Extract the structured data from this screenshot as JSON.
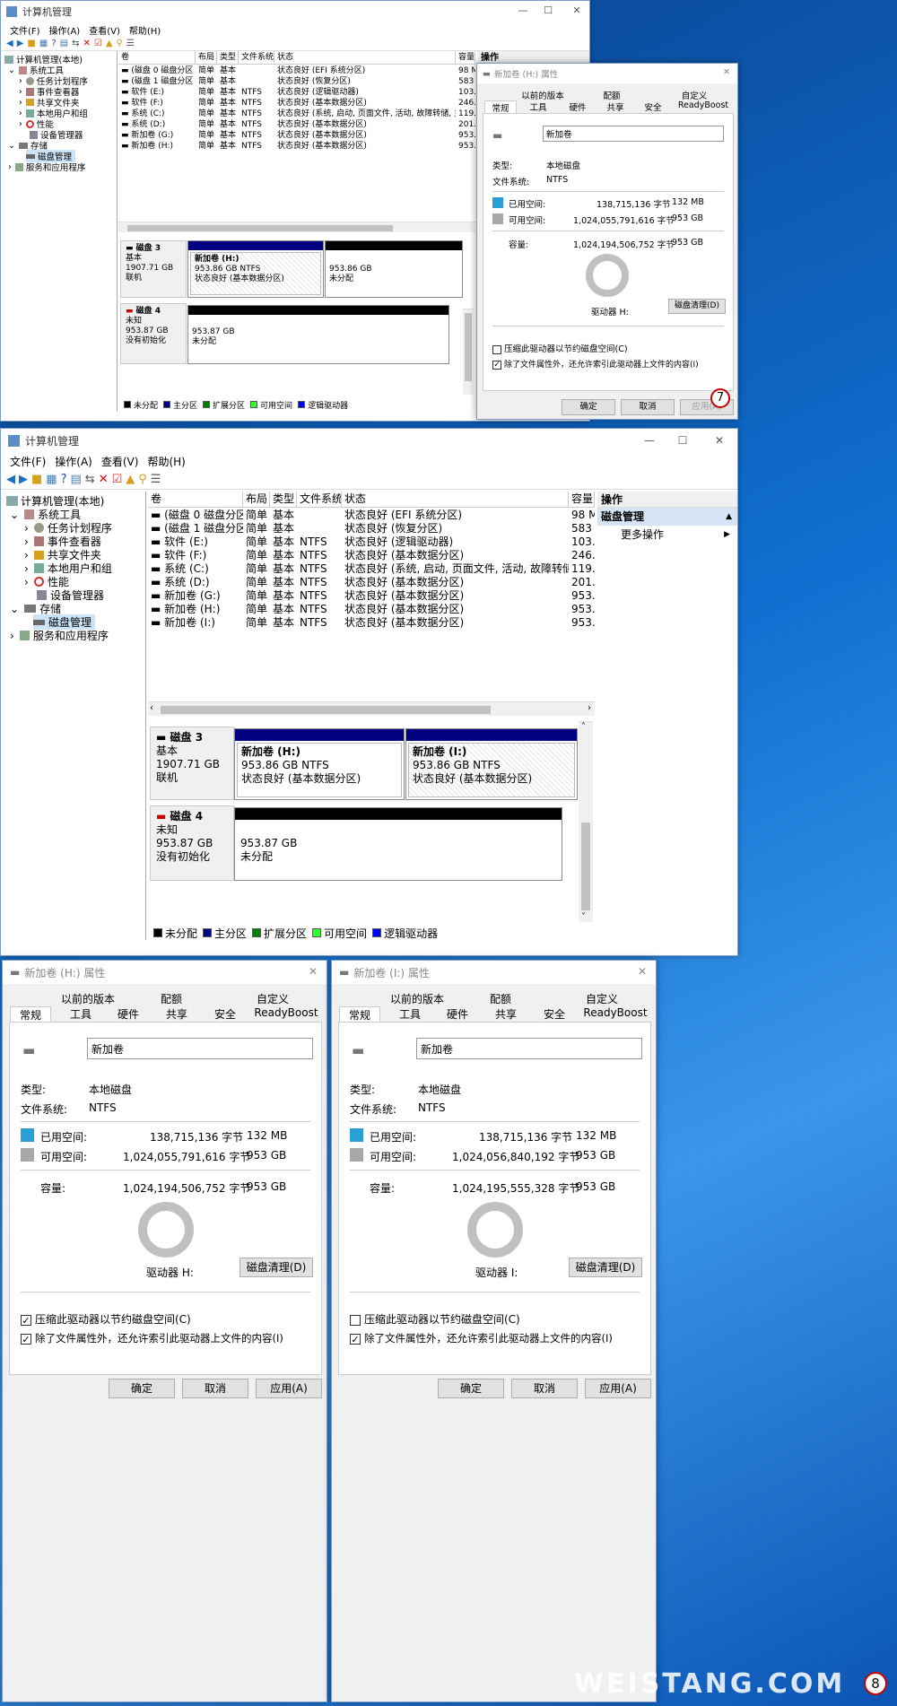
{
  "app_title": "计算机管理",
  "menu": [
    "文件(F)",
    "操作(A)",
    "查看(V)",
    "帮助(H)"
  ],
  "tree": {
    "root": "计算机管理(本地)",
    "system_tools": "系统工具",
    "task_scheduler": "任务计划程序",
    "event_viewer": "事件查看器",
    "shared_folders": "共享文件夹",
    "local_users": "本地用户和组",
    "performance": "性能",
    "device_manager": "设备管理器",
    "storage": "存储",
    "disk_mgmt": "磁盘管理",
    "services": "服务和应用程序"
  },
  "columns": [
    "卷",
    "布局",
    "类型",
    "文件系统",
    "状态",
    "容量"
  ],
  "volumes_a": [
    [
      "(磁盘 0 磁盘分区 1)",
      "简单",
      "基本",
      "",
      "状态良好 (EFI 系统分区)",
      "98 M"
    ],
    [
      "(磁盘 1 磁盘分区 2)",
      "简单",
      "基本",
      "",
      "状态良好 (恢复分区)",
      "583"
    ],
    [
      "软件 (E:)",
      "简单",
      "基本",
      "NTFS",
      "状态良好 (逻辑驱动器)",
      "103."
    ],
    [
      "软件 (F:)",
      "简单",
      "基本",
      "NTFS",
      "状态良好 (基本数据分区)",
      "246."
    ],
    [
      "系统 (C:)",
      "简单",
      "基本",
      "NTFS",
      "状态良好 (系统, 启动, 页面文件, 活动, 故障转储, 主分区)",
      "119."
    ],
    [
      "系统 (D:)",
      "简单",
      "基本",
      "NTFS",
      "状态良好 (基本数据分区)",
      "201."
    ],
    [
      "新加卷 (G:)",
      "简单",
      "基本",
      "NTFS",
      "状态良好 (基本数据分区)",
      "953."
    ],
    [
      "新加卷 (H:)",
      "简单",
      "基本",
      "NTFS",
      "状态良好 (基本数据分区)",
      "953."
    ]
  ],
  "volumes_b_extra": [
    "新加卷 (I:)",
    "简单",
    "基本",
    "NTFS",
    "状态良好 (基本数据分区)",
    "953."
  ],
  "disk3": {
    "name": "磁盘 3",
    "type": "基本",
    "size": "1907.71 GB",
    "status": "联机"
  },
  "disk4": {
    "name": "磁盘 4",
    "type": "未知",
    "size": "953.87 GB",
    "status": "没有初始化"
  },
  "part_h": {
    "name": "新加卷 (H:)",
    "size": "953.86 GB NTFS",
    "status": "状态良好 (基本数据分区)"
  },
  "part_i": {
    "name": "新加卷 (I:)",
    "size": "953.86 GB NTFS",
    "status": "状态良好 (基本数据分区)"
  },
  "unalloc_a": {
    "size": "953.86 GB",
    "status": "未分配"
  },
  "unalloc_b": {
    "size": "953.87 GB",
    "status": "未分配"
  },
  "legend": [
    "未分配",
    "主分区",
    "扩展分区",
    "可用空间",
    "逻辑驱动器"
  ],
  "legend_colors": [
    "#000000",
    "#000080",
    "#008000",
    "#33ff33",
    "#0000ff"
  ],
  "actions": {
    "header": "操作",
    "disk_mgmt": "磁盘管理",
    "more": "更多操作"
  },
  "dlg_h": {
    "title": "新加卷 (H:) 属性",
    "tabs_top": [
      "以前的版本",
      "配额",
      "自定义"
    ],
    "tabs_bottom": [
      "常规",
      "工具",
      "硬件",
      "共享",
      "安全",
      "ReadyBoost"
    ],
    "name": "新加卷",
    "type_label": "类型:",
    "type_value": "本地磁盘",
    "fs_label": "文件系统:",
    "fs_value": "NTFS",
    "used_label": "已用空间:",
    "used_bytes": "138,715,136 字节",
    "used_size": "132 MB",
    "free_label": "可用空间:",
    "free_bytes": "1,024,055,791,616 字节",
    "free_size": "953 GB",
    "cap_label": "容量:",
    "cap_bytes": "1,024,194,506,752 字节",
    "cap_size": "953 GB",
    "drive": "驱动器 H:",
    "cleanup": "磁盘清理(D)",
    "compress": "压缩此驱动器以节约磁盘空间(C)",
    "index": "除了文件属性外，还允许索引此驱动器上文件的内容(I)",
    "ok": "确定",
    "cancel": "取消",
    "apply": "应用(A)"
  },
  "dlg_i": {
    "title": "新加卷 (I:) 属性",
    "name": "新加卷",
    "used_bytes": "138,715,136 字节",
    "used_size": "132 MB",
    "free_bytes": "1,024,056,840,192 字节",
    "free_size": "953 GB",
    "cap_bytes": "1,024,195,555,328 字节",
    "cap_size": "953 GB",
    "drive": "驱动器 I:",
    "ok": "确定"
  },
  "step7": "7",
  "step8": "8",
  "watermark": "WEISTANG.COM",
  "colors": {
    "used": "#2a9fd6",
    "free": "#a8a8a8",
    "primary": "#000080"
  }
}
